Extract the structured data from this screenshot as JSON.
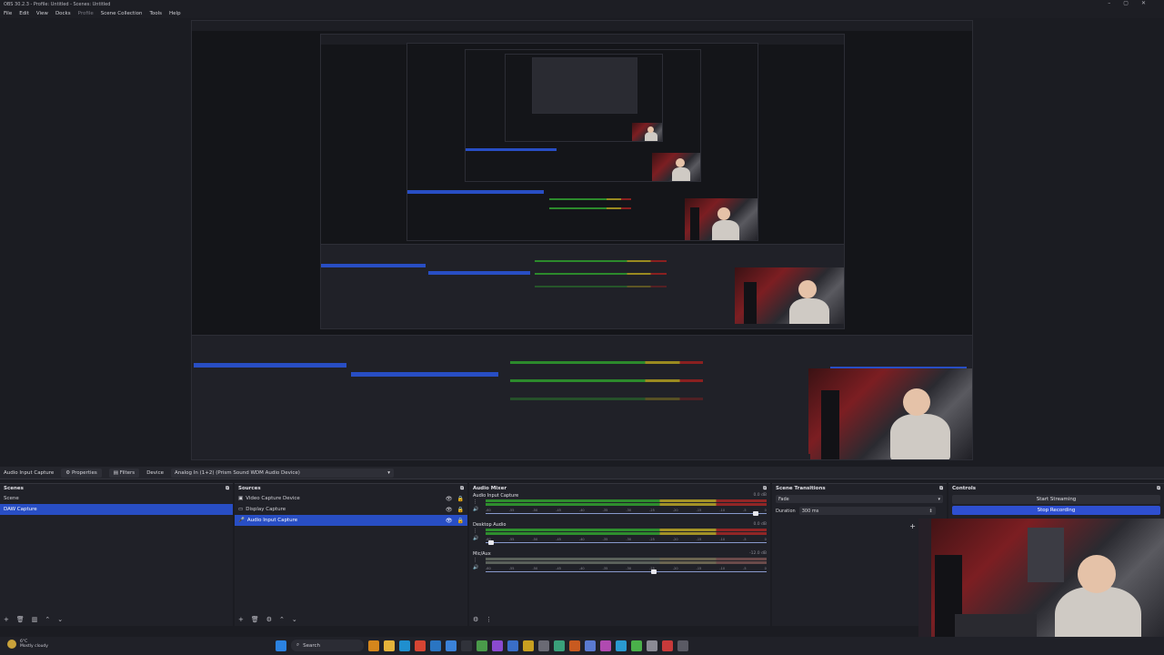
{
  "window": {
    "title": "OBS 30.2.3 - Profile: Untitled - Scenes: Untitled",
    "controls": [
      "–",
      "▢",
      "✕"
    ]
  },
  "menu": [
    "File",
    "Edit",
    "View",
    "Docks",
    "Profile",
    "Scene Collection",
    "Tools",
    "Help"
  ],
  "toolbar": {
    "source_name": "Audio Input Capture",
    "properties_label": "Properties",
    "filters_label": "Filters",
    "device_label": "Device",
    "device_value": "Analog In (1+2) (Prism Sound WDM Audio Device)"
  },
  "scenes": {
    "title": "Scenes",
    "items": [
      "Scene",
      "DAW Capture"
    ],
    "selected": 1
  },
  "sources": {
    "title": "Sources",
    "items": [
      {
        "label": "Video Capture Device",
        "icon": "camera-icon"
      },
      {
        "label": "Display Capture",
        "icon": "monitor-icon"
      },
      {
        "label": "Audio Input Capture",
        "icon": "mic-icon"
      }
    ],
    "selected": 2
  },
  "mixer": {
    "title": "Audio Mixer",
    "ticks": [
      "-60",
      "-55",
      "-50",
      "-45",
      "-40",
      "-35",
      "-30",
      "-25",
      "-20",
      "-15",
      "-10",
      "-5",
      "0"
    ],
    "channels": [
      {
        "name": "Audio Input Capture",
        "db": "0.0 dB",
        "muted": false,
        "fader": 0.96
      },
      {
        "name": "Desktop Audio",
        "db": "0.0 dB",
        "muted": false,
        "fader": 0.02
      },
      {
        "name": "Mic/Aux",
        "db": "-12.0 dB",
        "muted": true,
        "fader": 0.6
      }
    ]
  },
  "transitions": {
    "title": "Scene Transitions",
    "type": "Fade",
    "duration_label": "Duration",
    "duration_value": "300 ms"
  },
  "controls": {
    "title": "Controls",
    "start_streaming": "Start Streaming",
    "stop_recording": "Stop Recording"
  },
  "taskbar": {
    "weather_temp": "6°C",
    "weather_desc": "Mostly cloudy",
    "search_label": "Search"
  },
  "colors": {
    "selection": "#284ec4",
    "panel": "#202128",
    "background": "#1b1c22"
  }
}
